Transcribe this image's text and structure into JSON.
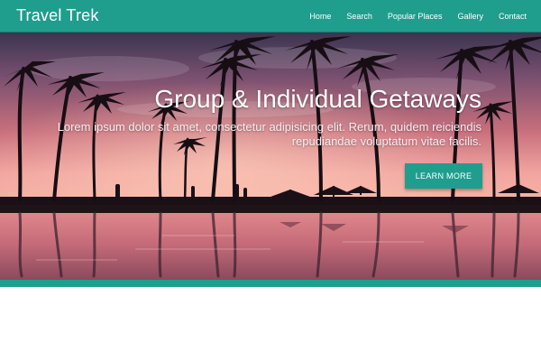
{
  "brand": {
    "name": "Travel Trek"
  },
  "nav": {
    "items": [
      {
        "label": "Home"
      },
      {
        "label": "Search"
      },
      {
        "label": "Popular Places"
      },
      {
        "label": "Gallery"
      },
      {
        "label": "Contact"
      }
    ]
  },
  "hero": {
    "title": "Group & Individual Getaways",
    "subtitle": "Lorem ipsum dolor sit amet, consectetur adipisicing elit. Rerum, quidem reiciendis repudiandae voluptatum vitae facilis.",
    "cta_label": "LEARN MORE"
  },
  "colors": {
    "accent": "#1f9e8e",
    "sky_top": "#3a3550",
    "sky_pink": "#c9707d",
    "horizon": "#f2a5a0"
  }
}
